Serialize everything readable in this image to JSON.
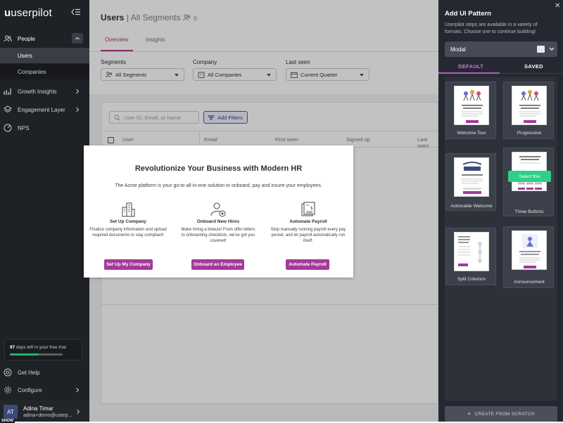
{
  "sidebar": {
    "brand": "userpilot",
    "nav": [
      {
        "label": "People",
        "icon": "people-icon"
      },
      {
        "label": "Growth Insights",
        "icon": "chart-icon"
      },
      {
        "label": "Engagement Layer",
        "icon": "layers-icon"
      },
      {
        "label": "NPS",
        "icon": "nps-icon"
      }
    ],
    "people_sub": [
      {
        "label": "Users"
      },
      {
        "label": "Companies"
      }
    ],
    "trial": {
      "days": "97",
      "text": "days left in your free trial",
      "progress": 0.55
    },
    "bottom": [
      {
        "label": "Get Help",
        "icon": "help-icon"
      },
      {
        "label": "Configure",
        "icon": "gear-icon"
      }
    ],
    "user": {
      "initials": "AT",
      "name": "Adina Timar",
      "email": "adina+demo@userp...",
      "tag": "SHOW"
    }
  },
  "header": {
    "title": "Users",
    "segment": "All Segments",
    "count": "0"
  },
  "tabs": [
    {
      "label": "Overview"
    },
    {
      "label": "Insights"
    }
  ],
  "filters": [
    {
      "label": "Segments",
      "value": "All Segments"
    },
    {
      "label": "Company",
      "value": "All Companies"
    },
    {
      "label": "Last seen",
      "value": "Current Quarter"
    }
  ],
  "search": {
    "placeholder": "User ID, Email, or Name"
  },
  "add_filters": "Add Filters",
  "columns": [
    "User",
    "Email",
    "First seen",
    "Signed up",
    "Last seen"
  ],
  "modal": {
    "title": "Revolutionize Your Business with Modern HR",
    "subtitle": "The Acme platform is your go-to all-in-one solution to onboard, pay and insure your employees.",
    "columns": [
      {
        "title": "Set Up Company",
        "desc": "Finalize company information and upload required documents to stay compliant!",
        "button": "Set Up My Company",
        "icon": "buildings-icon"
      },
      {
        "title": "Onboard New Hires",
        "desc": "Make hiring a breeze! From offer letters to onboarding checklists, we've got you covered!",
        "button": "Onboard an Employee",
        "icon": "add-user-icon"
      },
      {
        "title": "Automate Payroll",
        "desc": "Stop manually running payroll every pay period, and let payroll automatically run itself.",
        "button": "Automate Payroll",
        "icon": "payroll-icon"
      }
    ]
  },
  "panel": {
    "title": "Add UI Pattern",
    "subtitle": "Userpilot steps are available in a variety of formats. Choose one to continue building!",
    "format": "Modal",
    "tabs": [
      "DEFAULT",
      "SAVED"
    ],
    "templates": [
      {
        "label": "Welcome Tour"
      },
      {
        "label": "Progressive"
      },
      {
        "label": "Actionable Welcome"
      },
      {
        "label": "Three Buttons"
      },
      {
        "label": "Split Columns"
      },
      {
        "label": "Announcement"
      }
    ],
    "select_label": "Select this",
    "create_label": "CREATE FROM SCRATCH"
  },
  "colors": {
    "accent": "#a33a9a",
    "panel_bg": "#252831",
    "sidebar_bg": "#1e2126",
    "select_green": "#2fcf88"
  }
}
